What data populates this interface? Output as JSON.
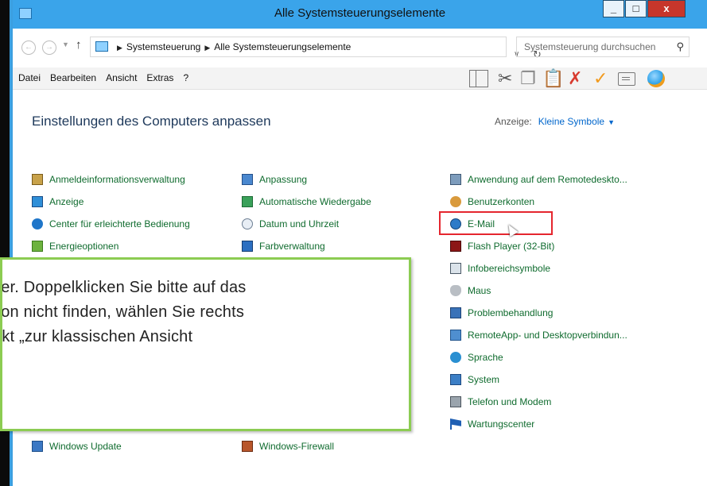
{
  "window": {
    "title": "Alle Systemsteuerungselemente",
    "min_glyph": "_",
    "max_glyph": "□",
    "close_glyph": "x"
  },
  "address": {
    "back_glyph": "←",
    "forward_glyph": "→",
    "dropdown_glyph": "▼",
    "up_glyph": "↑",
    "crumbs": [
      "Systemsteuerung",
      "Alle Systemsteuerungselemente"
    ],
    "crumb_sep_glyph": "▶",
    "addr_dropdown_glyph": "∨",
    "refresh_glyph": "↻",
    "search_placeholder": "Systemsteuerung durchsuchen",
    "search_glyph": "⚲"
  },
  "menu": {
    "items": [
      "Datei",
      "Bearbeiten",
      "Ansicht",
      "Extras",
      "?"
    ]
  },
  "toolbar": {
    "cut_glyph": "✂",
    "copy_glyph": "❐",
    "paste_glyph": "📋",
    "delete_glyph": "✗",
    "check_glyph": "✓"
  },
  "content": {
    "heading": "Einstellungen des Computers anpassen",
    "view_label": "Anzeige:",
    "view_value": "Kleine Symbole",
    "view_caret": "▼"
  },
  "items": {
    "col1": [
      "Anmeldeinformationsverwaltung",
      "Anzeige",
      "Center für erleichterte Bedienung",
      "Energieoptionen",
      "Windows Update"
    ],
    "col2": [
      "Anpassung",
      "Automatische Wiedergabe",
      "Datum und Uhrzeit",
      "Farbverwaltung",
      "Windows-Firewall"
    ],
    "col3": [
      "Anwendung auf dem Remotedeskto...",
      "Benutzerkonten",
      "E-Mail",
      "Flash Player (32-Bit)",
      "Infobereichsymbole",
      "Maus",
      "Problembehandlung",
      "RemoteApp- und Desktopverbindun...",
      "Sprache",
      "System",
      "Telefon und Modem",
      "Wartungscenter"
    ]
  },
  "callout": {
    "line1": "ser. Doppelklicken Sie bitte auf das",
    "line2": "con nicht finden, wählen Sie rechts",
    "line3": "nkt „zur klassischen Ansicht"
  },
  "colors": {
    "titlebar": "#3aa4ea",
    "link_green": "#0f6b2e",
    "heading_blue": "#1e395b",
    "callout_border": "#8ccc52",
    "highlight_red": "#e5262e"
  }
}
